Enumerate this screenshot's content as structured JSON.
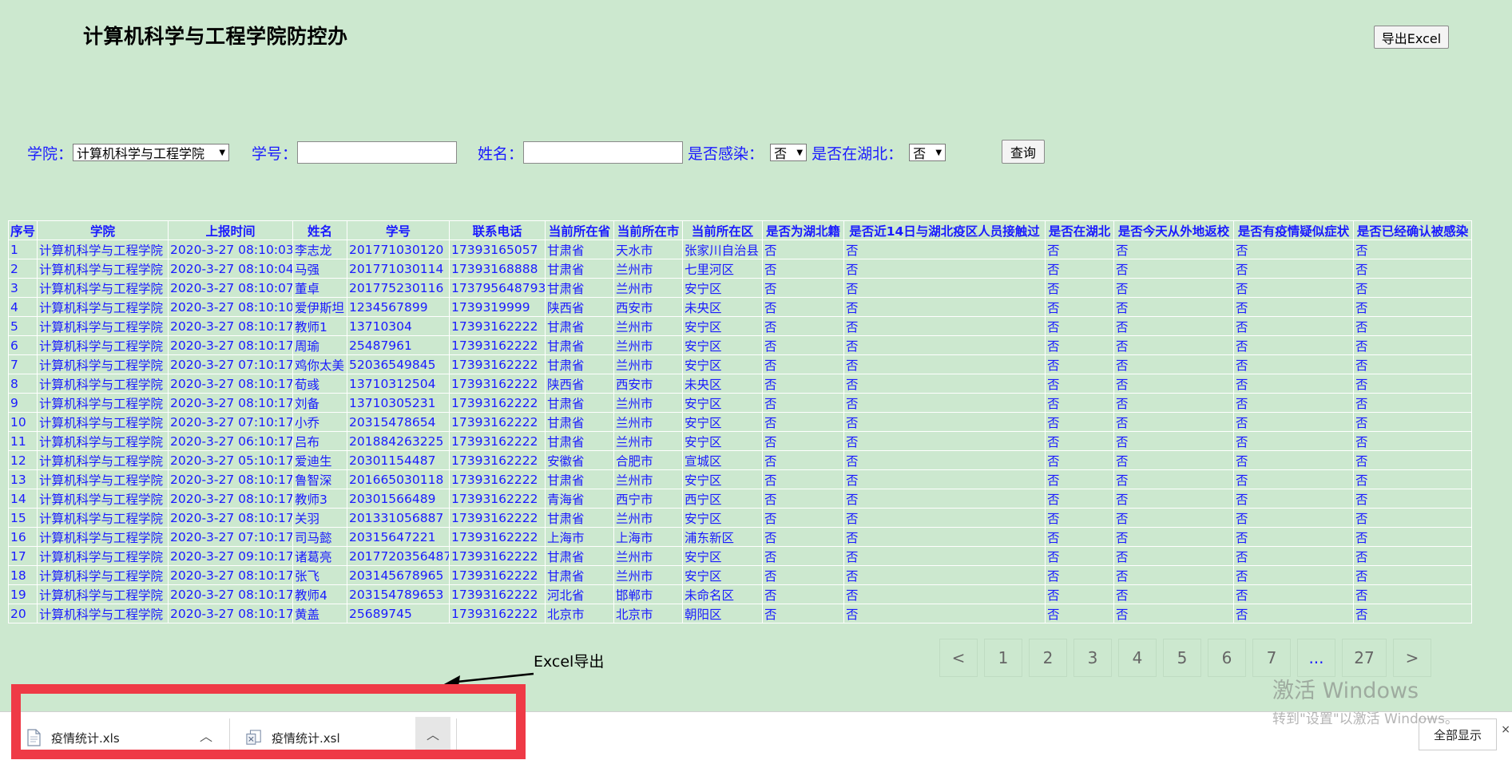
{
  "header": {
    "title": "计算机科学与工程学院防控办",
    "export_label": "导出Excel"
  },
  "filters": {
    "college_label": "学院：",
    "college_value": "计算机科学与工程学院",
    "student_id_label": "学号：",
    "student_id_value": "",
    "name_label": "姓名：",
    "name_value": "",
    "infected_label": "是否感染：",
    "infected_value": "否",
    "in_hubei_label": "是否在湖北：",
    "in_hubei_value": "否",
    "query_label": "查询"
  },
  "table": {
    "headers": [
      "序号",
      "学院",
      "上报时间",
      "姓名",
      "学号",
      "联系电话",
      "当前所在省",
      "当前所在市",
      "当前所在区",
      "是否为湖北籍",
      "是否近14日与湖北疫区人员接触过",
      "是否在湖北",
      "是否今天从外地返校",
      "是否有疫情疑似症状",
      "是否已经确认被感染"
    ],
    "rows": [
      [
        "1",
        "计算机科学与工程学院",
        "2020-3-27 08:10:03",
        "李志龙",
        "201771030120",
        "17393165057",
        "甘肃省",
        "天水市",
        "张家川自治县",
        "否",
        "否",
        "否",
        "否",
        "否",
        "否"
      ],
      [
        "2",
        "计算机科学与工程学院",
        "2020-3-27 08:10:04",
        "马强",
        "201771030114",
        "17393168888",
        "甘肃省",
        "兰州市",
        "七里河区",
        "否",
        "否",
        "否",
        "否",
        "否",
        "否"
      ],
      [
        "3",
        "计算机科学与工程学院",
        "2020-3-27 08:10:07",
        "董卓",
        "201775230116",
        "173795648793",
        "甘肃省",
        "兰州市",
        "安宁区",
        "否",
        "否",
        "否",
        "否",
        "否",
        "否"
      ],
      [
        "4",
        "计算机科学与工程学院",
        "2020-3-27 08:10:10",
        "爱伊斯坦",
        "1234567899",
        "1739319999",
        "陕西省",
        "西安市",
        "未央区",
        "否",
        "否",
        "否",
        "否",
        "否",
        "否"
      ],
      [
        "5",
        "计算机科学与工程学院",
        "2020-3-27 08:10:17",
        "教师1",
        "13710304",
        "17393162222",
        "甘肃省",
        "兰州市",
        "安宁区",
        "否",
        "否",
        "否",
        "否",
        "否",
        "否"
      ],
      [
        "6",
        "计算机科学与工程学院",
        "2020-3-27 08:10:17",
        "周瑜",
        "25487961",
        "17393162222",
        "甘肃省",
        "兰州市",
        "安宁区",
        "否",
        "否",
        "否",
        "否",
        "否",
        "否"
      ],
      [
        "7",
        "计算机科学与工程学院",
        "2020-3-27 07:10:17",
        "鸡你太美",
        "52036549845",
        "17393162222",
        "甘肃省",
        "兰州市",
        "安宁区",
        "否",
        "否",
        "否",
        "否",
        "否",
        "否"
      ],
      [
        "8",
        "计算机科学与工程学院",
        "2020-3-27 08:10:17",
        "荀彧",
        "13710312504",
        "17393162222",
        "陕西省",
        "西安市",
        "未央区",
        "否",
        "否",
        "否",
        "否",
        "否",
        "否"
      ],
      [
        "9",
        "计算机科学与工程学院",
        "2020-3-27 08:10:17",
        "刘备",
        "13710305231",
        "17393162222",
        "甘肃省",
        "兰州市",
        "安宁区",
        "否",
        "否",
        "否",
        "否",
        "否",
        "否"
      ],
      [
        "10",
        "计算机科学与工程学院",
        "2020-3-27 07:10:17",
        "小乔",
        "20315478654",
        "17393162222",
        "甘肃省",
        "兰州市",
        "安宁区",
        "否",
        "否",
        "否",
        "否",
        "否",
        "否"
      ],
      [
        "11",
        "计算机科学与工程学院",
        "2020-3-27 06:10:17",
        "吕布",
        "201884263225",
        "17393162222",
        "甘肃省",
        "兰州市",
        "安宁区",
        "否",
        "否",
        "否",
        "否",
        "否",
        "否"
      ],
      [
        "12",
        "计算机科学与工程学院",
        "2020-3-27 05:10:17",
        "爱迪生",
        "20301154487",
        "17393162222",
        "安徽省",
        "合肥市",
        "宣城区",
        "否",
        "否",
        "否",
        "否",
        "否",
        "否"
      ],
      [
        "13",
        "计算机科学与工程学院",
        "2020-3-27 08:10:17",
        "鲁智深",
        "201665030118",
        "17393162222",
        "甘肃省",
        "兰州市",
        "安宁区",
        "否",
        "否",
        "否",
        "否",
        "否",
        "否"
      ],
      [
        "14",
        "计算机科学与工程学院",
        "2020-3-27 08:10:17",
        "教师3",
        "20301566489",
        "17393162222",
        "青海省",
        "西宁市",
        "西宁区",
        "否",
        "否",
        "否",
        "否",
        "否",
        "否"
      ],
      [
        "15",
        "计算机科学与工程学院",
        "2020-3-27 08:10:17",
        "关羽",
        "201331056887",
        "17393162222",
        "甘肃省",
        "兰州市",
        "安宁区",
        "否",
        "否",
        "否",
        "否",
        "否",
        "否"
      ],
      [
        "16",
        "计算机科学与工程学院",
        "2020-3-27 07:10:17",
        "司马懿",
        "20315647221",
        "17393162222",
        "上海市",
        "上海市",
        "浦东新区",
        "否",
        "否",
        "否",
        "否",
        "否",
        "否"
      ],
      [
        "17",
        "计算机科学与工程学院",
        "2020-3-27 09:10:17",
        "诸葛亮",
        "2017720356487",
        "17393162222",
        "甘肃省",
        "兰州市",
        "安宁区",
        "否",
        "否",
        "否",
        "否",
        "否",
        "否"
      ],
      [
        "18",
        "计算机科学与工程学院",
        "2020-3-27 08:10:17",
        "张飞",
        "203145678965",
        "17393162222",
        "甘肃省",
        "兰州市",
        "安宁区",
        "否",
        "否",
        "否",
        "否",
        "否",
        "否"
      ],
      [
        "19",
        "计算机科学与工程学院",
        "2020-3-27 08:10:17",
        "教师4",
        "203154789653",
        "17393162222",
        "河北省",
        "邯郸市",
        "未命名区",
        "否",
        "否",
        "否",
        "否",
        "否",
        "否"
      ],
      [
        "20",
        "计算机科学与工程学院",
        "2020-3-27 08:10:17",
        "黄盖",
        "25689745",
        "17393162222",
        "北京市",
        "北京市",
        "朝阳区",
        "否",
        "否",
        "否",
        "否",
        "否",
        "否"
      ]
    ]
  },
  "pagination": {
    "prev": "<",
    "pages": [
      "1",
      "2",
      "3",
      "4",
      "5",
      "6",
      "7",
      "...",
      "27"
    ],
    "next": ">"
  },
  "annotation": {
    "label": "Excel导出"
  },
  "downloads": {
    "items": [
      {
        "filename": "疫情统计.xls"
      },
      {
        "filename": "疫情统计.xsl"
      }
    ],
    "show_all_label": "全部显示"
  },
  "watermark": {
    "line1": "激活 Windows",
    "line2": "转到\"设置\"以激活 Windows。"
  },
  "colors": {
    "background": "#cce8cf",
    "link_text": "#1a1aff",
    "highlight_box": "#ef3a46"
  }
}
